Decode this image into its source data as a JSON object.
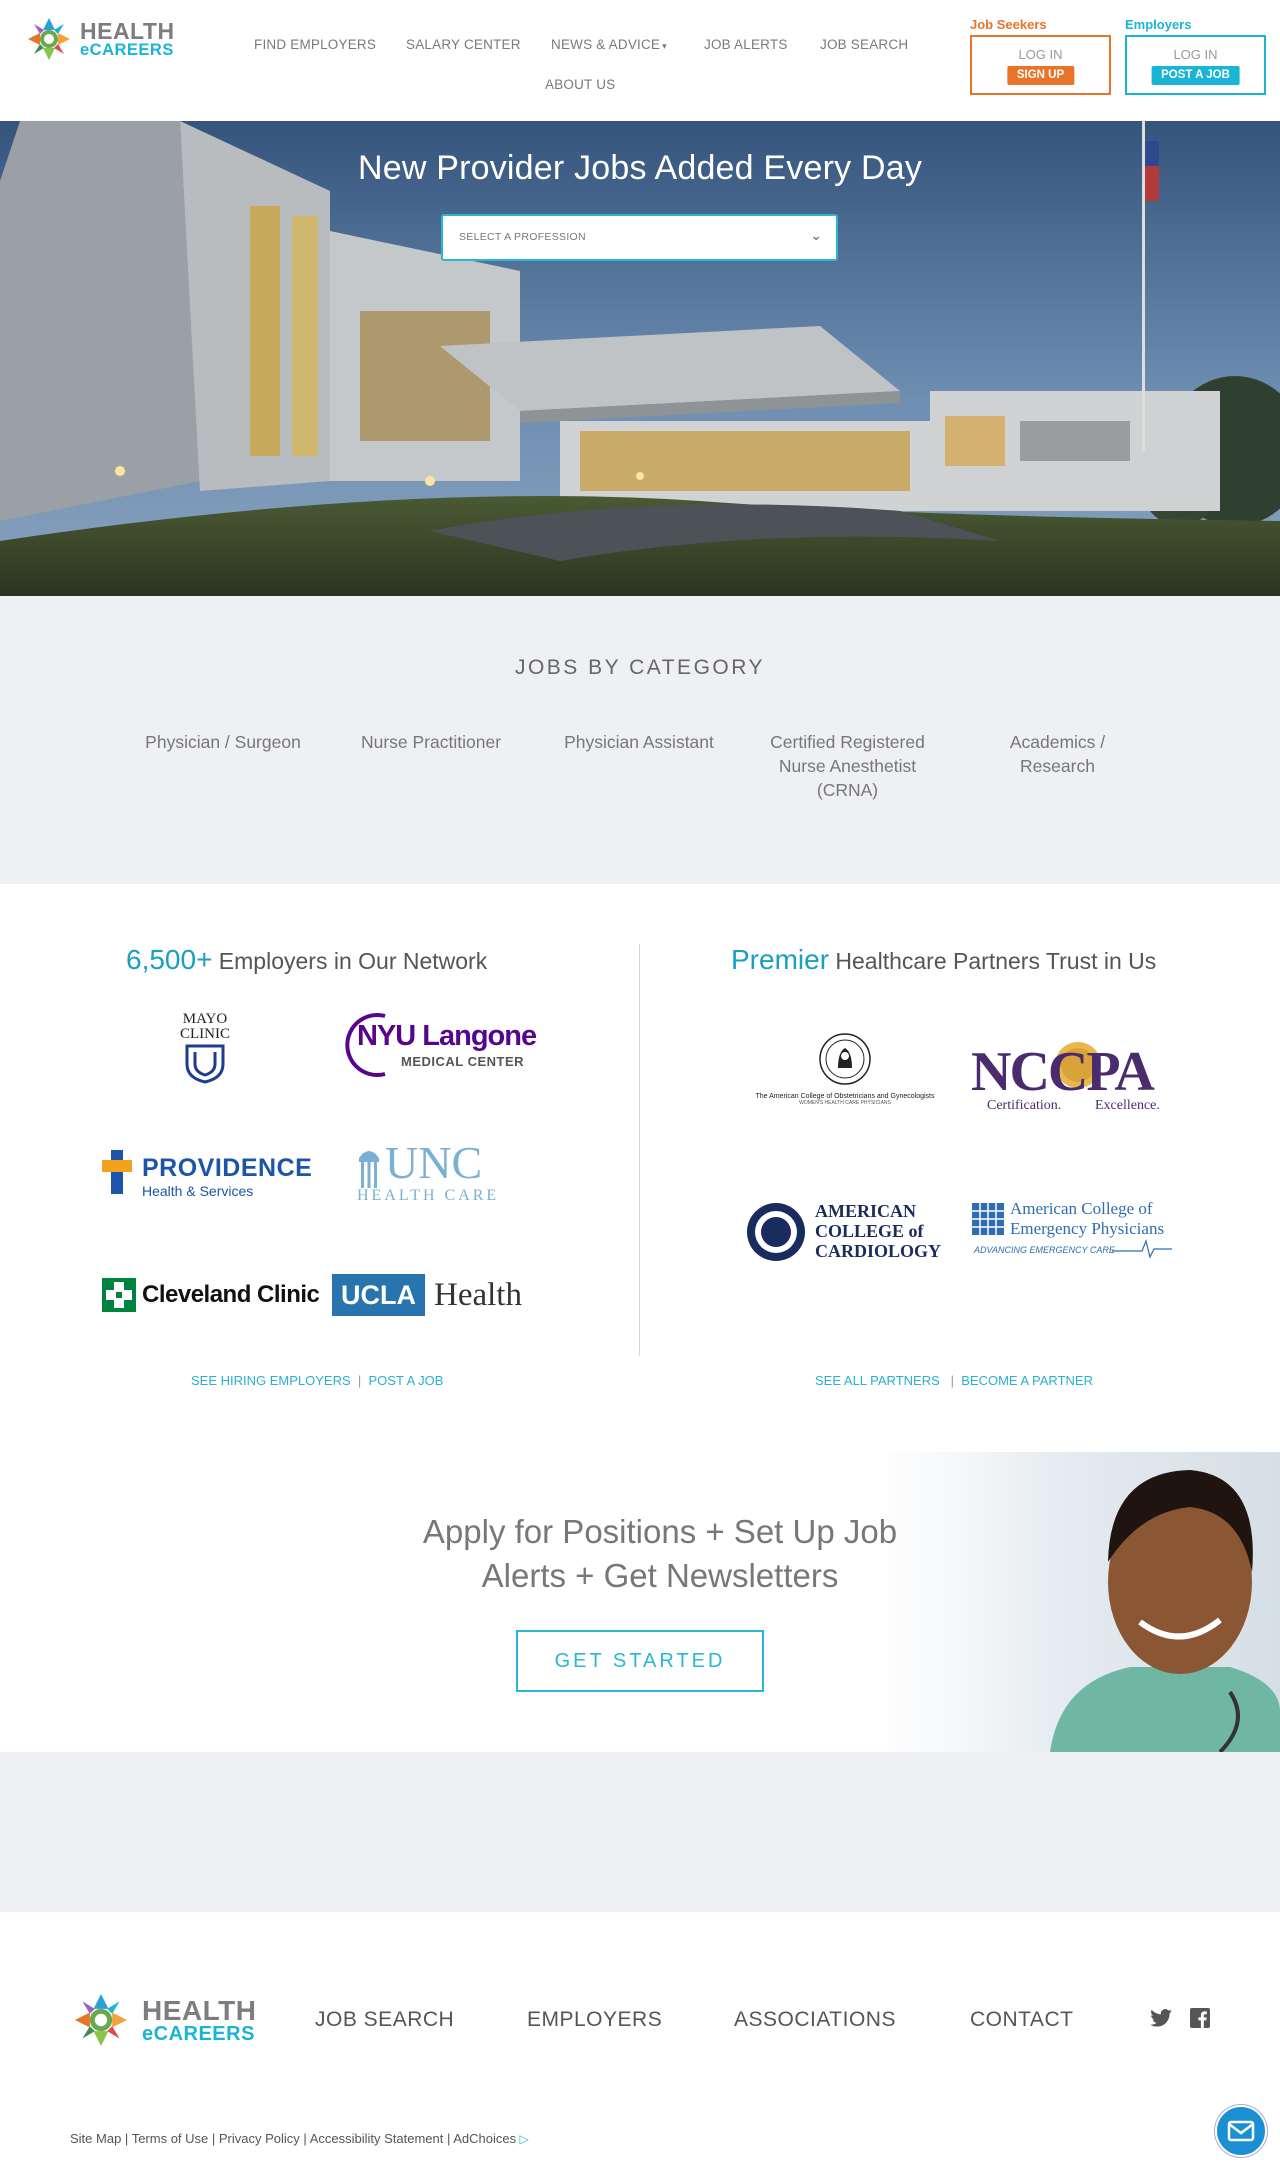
{
  "header": {
    "logo": {
      "line1": "HEALTH",
      "line2": "eCAREERS"
    },
    "nav": [
      "FIND EMPLOYERS",
      "SALARY CENTER",
      "NEWS & ADVICE",
      "JOB ALERTS",
      "JOB SEARCH",
      "ABOUT US"
    ],
    "job_seekers": {
      "label": "Job Seekers",
      "login": "LOG IN",
      "action": "SIGN UP",
      "color": "#e8742a"
    },
    "employers": {
      "label": "Employers",
      "login": "LOG IN",
      "action": "POST A JOB",
      "color": "#1ab4d4"
    }
  },
  "hero": {
    "title": "New Provider Jobs Added Every Day",
    "select_placeholder": "SELECT A PROFESSION"
  },
  "categories": {
    "heading": "JOBS BY CATEGORY",
    "items": [
      "Physician / Surgeon",
      "Nurse Practitioner",
      "Physician Assistant",
      "Certified Registered Nurse Anesthetist (CRNA)",
      "Academics / Research"
    ]
  },
  "network": {
    "left": {
      "highlight": "6,500+",
      "rest": " Employers in Our Network",
      "logos": {
        "mayo": "MAYO CLINIC",
        "nyu_1": "NYU Langone",
        "nyu_2": "MEDICAL CENTER",
        "providence_1": "PROVIDENCE",
        "providence_2": "Health & Services",
        "unc_1": "UNC",
        "unc_2": "HEALTH CARE",
        "cleveland": "Cleveland Clinic",
        "ucla_1": "UCLA",
        "ucla_2": "Health"
      },
      "link1": "SEE HIRING EMPLOYERS",
      "link2": "POST A JOB"
    },
    "right": {
      "highlight": "Premier",
      "rest": " Healthcare Partners Trust in Us",
      "logos": {
        "acog_1": "The American College of Obstetricians and Gynecologists",
        "acog_2": "WOMEN'S HEALTH CARE PHYSICIANS",
        "nccpa_1": "NCCPA",
        "nccpa_2": "Certification.",
        "nccpa_3": "Excellence.",
        "acc_1": "AMERICAN",
        "acc_2": "COLLEGE of",
        "acc_3": "CARDIOLOGY",
        "acep_1": "American College of",
        "acep_2": "Emergency Physicians",
        "acep_3": "ADVANCING EMERGENCY CARE"
      },
      "link1": "SEE ALL PARTNERS",
      "link2": "BECOME A PARTNER"
    }
  },
  "cta": {
    "line1": "Apply for Positions + Set Up Job",
    "line2": "Alerts + Get Newsletters",
    "button": "GET STARTED"
  },
  "footer": {
    "nav": [
      "JOB SEARCH",
      "EMPLOYERS",
      "ASSOCIATIONS",
      "CONTACT"
    ],
    "legal": [
      "Site Map",
      "Terms of Use",
      "Privacy Policy",
      "Accessibility Statement",
      "AdChoices"
    ],
    "social": [
      "twitter-icon",
      "facebook-icon"
    ]
  },
  "colors": {
    "accent": "#1ab4d4",
    "orange": "#e8742a",
    "bg_gray": "#eef0f4"
  }
}
